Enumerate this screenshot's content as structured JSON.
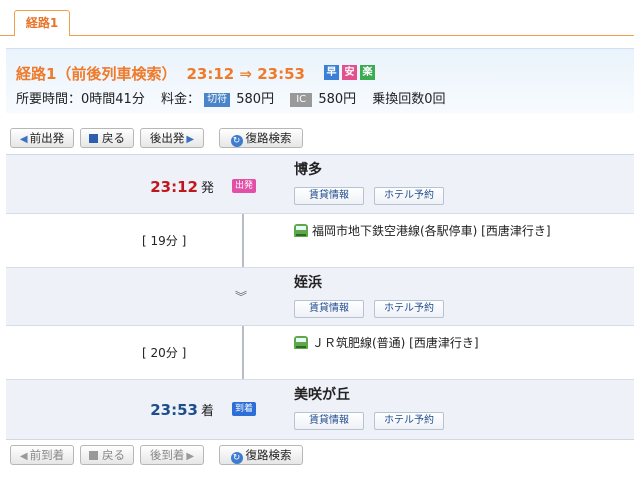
{
  "tab": {
    "label": "経路1"
  },
  "summary": {
    "title": "経路1（前後列車検索）",
    "times": "23:12 ⇒ 23:53",
    "badges": [
      "早",
      "安",
      "楽"
    ],
    "duration_label": "所要時間：0時間41分",
    "fare_label": "料金：",
    "ticket_tag": "切符",
    "ticket_fare": "580円",
    "ic_tag": "IC",
    "ic_fare": "580円",
    "transfers": "乗換回数0回"
  },
  "toolbar_top": {
    "prev": "前出発",
    "back": "戻る",
    "next": "後出発",
    "reverse": "復路検索"
  },
  "route": {
    "stations": [
      {
        "time": "23:12",
        "suffix": "発",
        "mark": "出発",
        "name": "博多",
        "btn_rent": "賃貸情報",
        "btn_hotel": "ホテル予約"
      },
      {
        "name": "姪浜",
        "btn_rent": "賃貸情報",
        "btn_hotel": "ホテル予約"
      },
      {
        "time": "23:53",
        "suffix": "着",
        "mark": "到着",
        "name": "美咲が丘",
        "btn_rent": "賃貸情報",
        "btn_hotel": "ホテル予約"
      }
    ],
    "segments": [
      {
        "duration": "[ 19分 ]",
        "line": "福岡市地下鉄空港線(各駅停車) [西唐津行き]"
      },
      {
        "duration": "[ 20分 ]",
        "line": "ＪＲ筑肥線(普通) [西唐津行き]"
      }
    ]
  },
  "toolbar_bottom": {
    "prev": "前到着",
    "back": "戻る",
    "next": "後到着",
    "reverse": "復路検索"
  },
  "colors": {
    "accent": "#ee7a2c",
    "dep_time": "#c0171d",
    "arr_time": "#1d4d8c"
  }
}
